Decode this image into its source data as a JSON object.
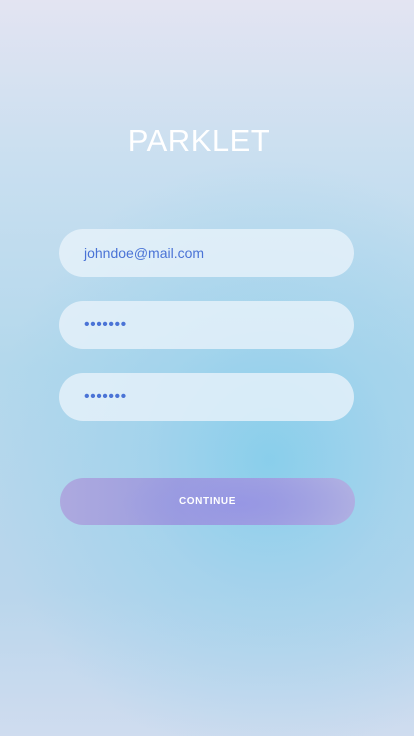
{
  "app": {
    "title": "PARKLET"
  },
  "form": {
    "email_value": "johndoe@mail.com",
    "password_value": "•••••••",
    "confirm_password_value": "•••••••",
    "continue_label": "CONTINUE"
  },
  "colors": {
    "input_text": "#4a73d6",
    "button_bg": "#a0a2e0",
    "title_text": "#ffffff"
  }
}
